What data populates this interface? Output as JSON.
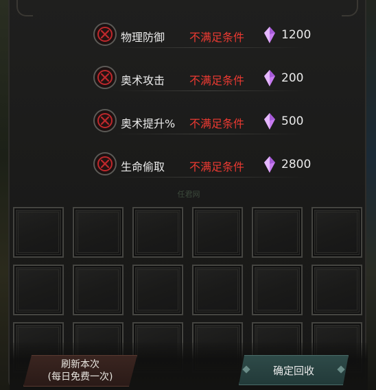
{
  "requirements": [
    {
      "name": "物理防御",
      "status": "不满足条件",
      "cost": "1200"
    },
    {
      "name": "奥术攻击",
      "status": "不满足条件",
      "cost": "200"
    },
    {
      "name": "奥术提升%",
      "status": "不满足条件",
      "cost": "500"
    },
    {
      "name": "生命偷取",
      "status": "不满足条件",
      "cost": "2800"
    }
  ],
  "ghost_label": "任君网",
  "buttons": {
    "refresh_line1": "刷新本次",
    "refresh_line2": "(每日免费一次)",
    "confirm": "确定回收"
  },
  "icons": {
    "status_icon": "red-x-circle-icon",
    "cost_icon": "purple-crystal-icon"
  },
  "colors": {
    "status_red": "#ee3a32",
    "crystal_purple": "#c77bf0",
    "confirm_teal": "#2e4a48"
  }
}
